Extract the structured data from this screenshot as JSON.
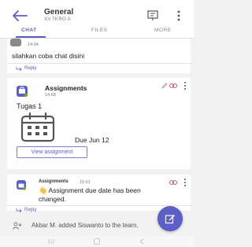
{
  "header": {
    "title": "General",
    "subtitle": "XII TKRO A"
  },
  "tabs": [
    "CHAT",
    "FILES",
    "MORE"
  ],
  "messages": [
    {
      "time": "14:34",
      "text": "silahkan coba chat disini",
      "reply": "Reply"
    },
    {
      "sender": "Assignments",
      "time": "14:58",
      "card_title": "Tugas 1",
      "due": "Due Jun 12",
      "button": "View assignment"
    },
    {
      "sender": "Assignments",
      "time": "15:01",
      "emoji": "👋",
      "text_line1": "Assignment due date has been",
      "text_line2": "changed.",
      "reply": "Reply"
    }
  ],
  "system": {
    "text": "Akbar M. added Siswanto to the team."
  },
  "colors": {
    "accent": "#5b5fc7",
    "alert": "#d13438"
  }
}
